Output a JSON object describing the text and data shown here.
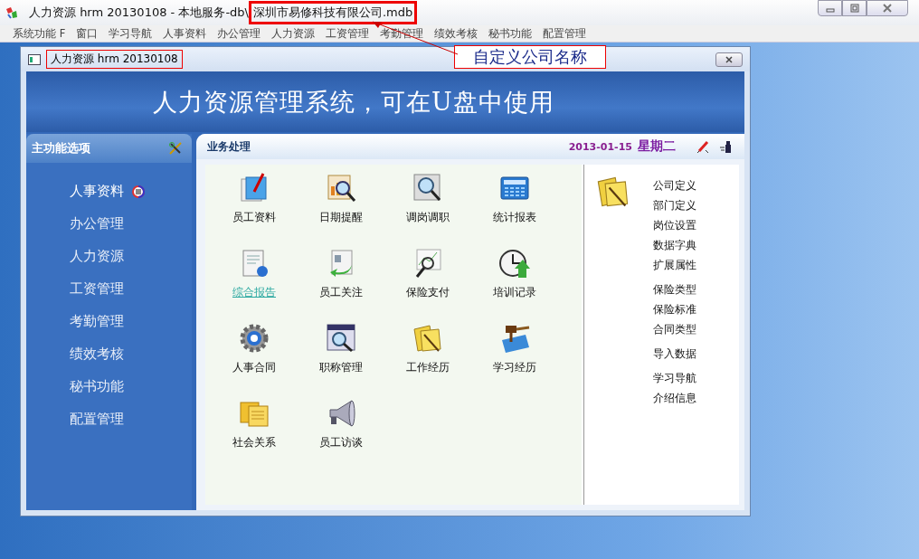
{
  "window": {
    "title": "人力资源 hrm 20130108 - 本地服务-db\\",
    "file_name": "深圳市易修科技有限公司.mdb"
  },
  "menu": [
    "系统功能 F",
    "窗口",
    "学习导航",
    "人事资料",
    "办公管理",
    "人力资源",
    "工资管理",
    "考勤管理",
    "绩效考核",
    "秘书功能",
    "配置管理"
  ],
  "annotation": {
    "text": "自定义公司名称"
  },
  "child_window": {
    "title": "人力资源 hrm 20130108"
  },
  "banner": {
    "title": "人力资源管理系统，可在U盘中使用"
  },
  "sidebar": {
    "title": "主功能选项",
    "items": [
      {
        "label": "人事资料",
        "selected": true
      },
      {
        "label": "办公管理",
        "selected": false
      },
      {
        "label": "人力资源",
        "selected": false
      },
      {
        "label": "工资管理",
        "selected": false
      },
      {
        "label": "考勤管理",
        "selected": false
      },
      {
        "label": "绩效考核",
        "selected": false
      },
      {
        "label": "秘书功能",
        "selected": false
      },
      {
        "label": "配置管理",
        "selected": false
      }
    ]
  },
  "panel": {
    "title": "业务处理",
    "date": "2013-01-15",
    "weekday": "星期二"
  },
  "tiles": [
    {
      "label": "员工资料",
      "hovered": false
    },
    {
      "label": "日期提醒",
      "hovered": false
    },
    {
      "label": "调岗调职",
      "hovered": false
    },
    {
      "label": "统计报表",
      "hovered": false
    },
    {
      "label": "综合报告",
      "hovered": true
    },
    {
      "label": "员工关注",
      "hovered": false
    },
    {
      "label": "保险支付",
      "hovered": false
    },
    {
      "label": "培训记录",
      "hovered": false
    },
    {
      "label": "人事合同",
      "hovered": false
    },
    {
      "label": "职称管理",
      "hovered": false
    },
    {
      "label": "工作经历",
      "hovered": false
    },
    {
      "label": "学习经历",
      "hovered": false
    },
    {
      "label": "社会关系",
      "hovered": false
    },
    {
      "label": "员工访谈",
      "hovered": false
    }
  ],
  "settings_groups": [
    [
      "公司定义",
      "部门定义",
      "岗位设置",
      "数据字典",
      "扩展属性"
    ],
    [
      "保险类型",
      "保险标准",
      "合同类型"
    ],
    [
      "导入数据"
    ],
    [
      "学习导航",
      "介绍信息"
    ]
  ]
}
